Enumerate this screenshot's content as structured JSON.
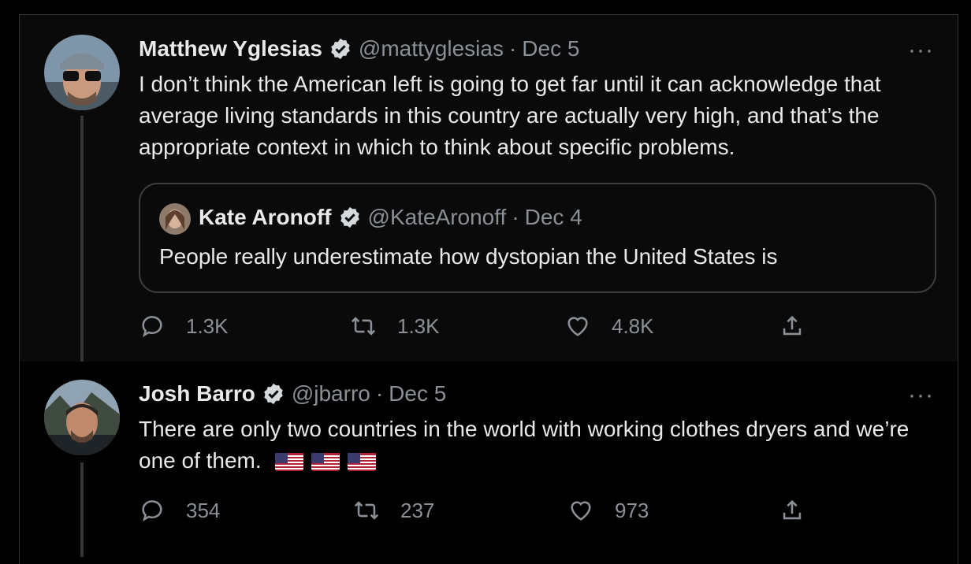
{
  "tweets": [
    {
      "name": "Matthew Yglesias",
      "handle": "@mattyglesias",
      "separator": "·",
      "date": "Dec 5",
      "more": "···",
      "text": "I don’t think the American left is going to get far until it can acknowledge that average living standards in this country are actually very high, and that’s the appropriate context in which to think about specific problems.",
      "quote": {
        "name": "Kate Aronoff",
        "handle": "@KateAronoff",
        "separator": "·",
        "date": "Dec 4",
        "text": "People really underestimate how dystopian the United States is"
      },
      "stats": {
        "replies": "1.3K",
        "retweets": "1.3K",
        "likes": "4.8K"
      }
    },
    {
      "name": "Josh Barro",
      "handle": "@jbarro",
      "separator": "·",
      "date": "Dec 5",
      "more": "···",
      "text": "There are only two countries in the world with working clothes dryers and we’re one of them.",
      "emoji": [
        "us-flag",
        "us-flag",
        "us-flag"
      ],
      "stats": {
        "replies": "354",
        "retweets": "237",
        "likes": "973"
      }
    }
  ],
  "icons": [
    "verified-badge-icon",
    "reply-icon",
    "retweet-icon",
    "like-icon",
    "share-icon",
    "more-icon"
  ],
  "colors": {
    "background": "#000000",
    "text": "#e7e9ea",
    "muted": "#8b9096",
    "border": "#2f3336"
  }
}
